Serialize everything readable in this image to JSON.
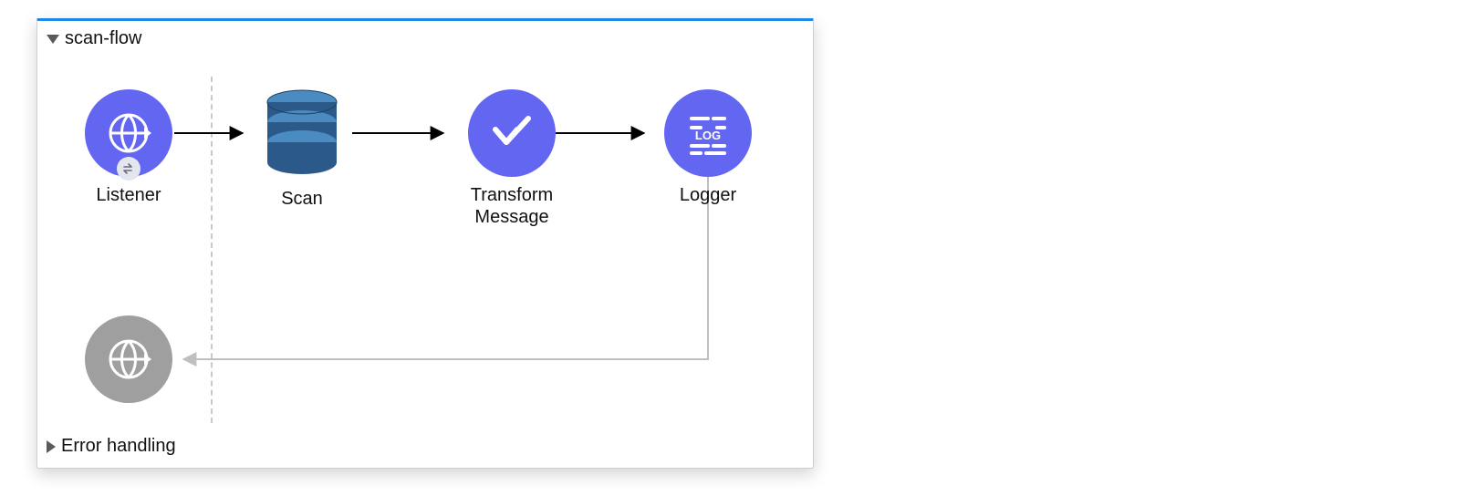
{
  "flow": {
    "title": "scan-flow",
    "expanded": true,
    "nodes": [
      {
        "id": "listener",
        "label": "Listener",
        "icon": "globe-arrow-icon",
        "color": "purple"
      },
      {
        "id": "scan",
        "label": "Scan",
        "icon": "database-icon",
        "color": "db"
      },
      {
        "id": "transform",
        "label": "Transform\nMessage",
        "icon": "transform-icon",
        "color": "purple"
      },
      {
        "id": "logger",
        "label": "Logger",
        "icon": "log-icon",
        "color": "purple"
      }
    ],
    "response_node": {
      "icon": "globe-arrow-icon",
      "color": "gray"
    }
  },
  "error_section": {
    "title": "Error handling",
    "expanded": false
  },
  "colors": {
    "purple": "#6366F1",
    "accent_top": "#1e88e5",
    "gray_node": "#9f9f9f",
    "db_dark": "#2b5a8a",
    "db_light": "#4a8bc2"
  }
}
